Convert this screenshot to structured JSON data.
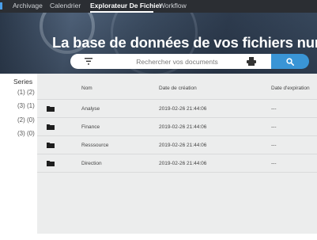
{
  "nav": {
    "items": [
      {
        "label": "Archivage",
        "active": false
      },
      {
        "label": "Calendrier",
        "active": false
      },
      {
        "label": "Explorateur De Fichier",
        "active": true
      },
      {
        "label": "Workflow",
        "active": false
      }
    ]
  },
  "banner": {
    "title": "La base de données de vos fichiers numérisés"
  },
  "search": {
    "placeholder": "Rechercher vos documents",
    "filter_icon": "filter-icon",
    "scan_icon": "scanner-icon",
    "button_icon": "search-icon"
  },
  "sidebar": {
    "title": "Series",
    "items": [
      "(1) (2)",
      "(3) (1)",
      "(2) (0)",
      "(3) (0)"
    ]
  },
  "table": {
    "columns": [
      "Nom",
      "Date de création",
      "Date d'expiration"
    ],
    "rows": [
      {
        "name": "Analyse",
        "created": "2019-02-26 21:44:06",
        "expires": "---"
      },
      {
        "name": "Finance",
        "created": "2019-02-26 21:44:06",
        "expires": "---"
      },
      {
        "name": "Resssource",
        "created": "2019-02-26 21:44:06",
        "expires": "---"
      },
      {
        "name": "Direction",
        "created": "2019-02-26 21:44:06",
        "expires": "---"
      }
    ]
  },
  "colors": {
    "nav_bg": "#2b2e33",
    "accent": "#3a95d6",
    "table_bg": "#eceded"
  }
}
